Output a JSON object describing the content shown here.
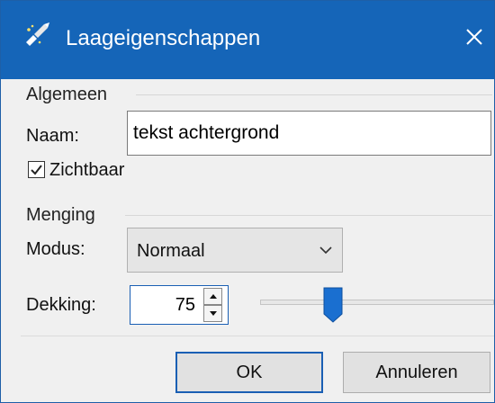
{
  "window": {
    "title": "Laageigenschappen",
    "close_icon": "close-icon",
    "title_icon": "layer-properties-icon",
    "titlebar_color": "#1565b8"
  },
  "general": {
    "section_label": "Algemeen",
    "name_label": "Naam:",
    "name_value": "tekst achtergrond",
    "visible_label": "Zichtbaar",
    "visible_checked": true
  },
  "blending": {
    "section_label": "Menging",
    "mode_label": "Modus:",
    "mode_value": "Normaal",
    "opacity_label": "Dekking:",
    "opacity_value": "75",
    "opacity_fraction": 0.75
  },
  "buttons": {
    "ok_label": "OK",
    "cancel_label": "Annuleren"
  }
}
